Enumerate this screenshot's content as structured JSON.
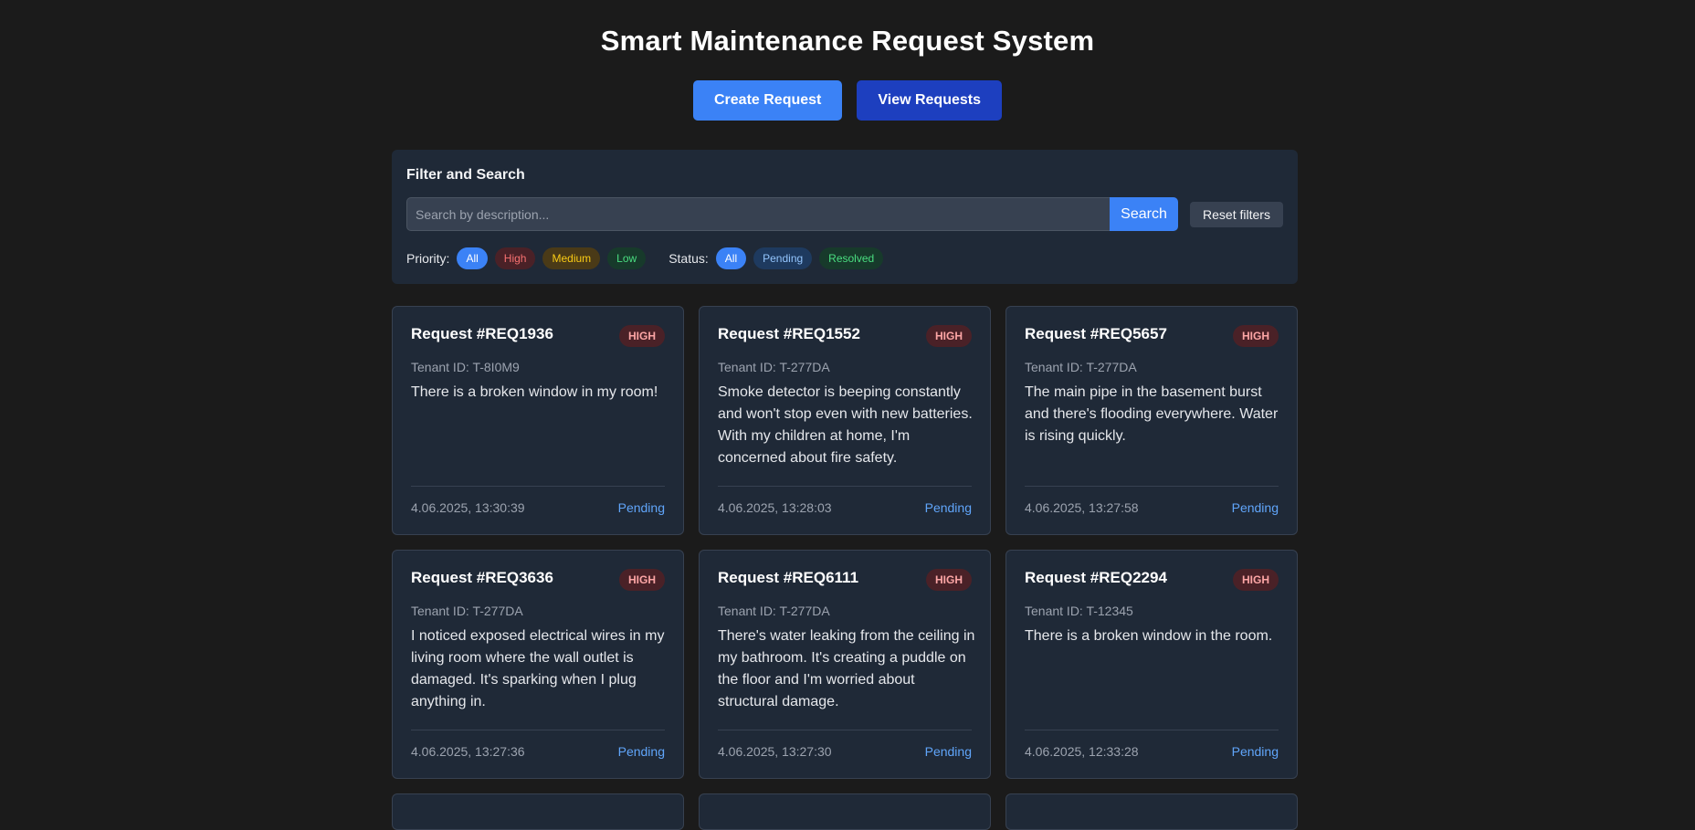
{
  "header": {
    "title": "Smart Maintenance Request System",
    "create_label": "Create Request",
    "view_label": "View Requests"
  },
  "filter": {
    "title": "Filter and Search",
    "search_placeholder": "Search by description...",
    "search_label": "Search",
    "reset_label": "Reset filters",
    "priority_label": "Priority:",
    "priority_options": [
      "All",
      "High",
      "Medium",
      "Low"
    ],
    "status_label": "Status:",
    "status_options": [
      "All",
      "Pending",
      "Resolved"
    ]
  },
  "requests": [
    {
      "title": "Request #REQ1936",
      "priority": "HIGH",
      "tenant": "Tenant ID: T-8I0M9",
      "description": "There is a broken window in my room!",
      "timestamp": "4.06.2025, 13:30:39",
      "status": "Pending"
    },
    {
      "title": "Request #REQ1552",
      "priority": "HIGH",
      "tenant": "Tenant ID: T-277DA",
      "description": "Smoke detector is beeping constantly and won't stop even with new batteries. With my children at home, I'm concerned about fire safety.",
      "timestamp": "4.06.2025, 13:28:03",
      "status": "Pending"
    },
    {
      "title": "Request #REQ5657",
      "priority": "HIGH",
      "tenant": "Tenant ID: T-277DA",
      "description": "The main pipe in the basement burst and there's flooding everywhere. Water is rising quickly.",
      "timestamp": "4.06.2025, 13:27:58",
      "status": "Pending"
    },
    {
      "title": "Request #REQ3636",
      "priority": "HIGH",
      "tenant": "Tenant ID: T-277DA",
      "description": "I noticed exposed electrical wires in my living room where the wall outlet is damaged. It's sparking when I plug anything in.",
      "timestamp": "4.06.2025, 13:27:36",
      "status": "Pending"
    },
    {
      "title": "Request #REQ6111",
      "priority": "HIGH",
      "tenant": "Tenant ID: T-277DA",
      "description": "There's water leaking from the ceiling in my bathroom. It's creating a puddle on the floor and I'm worried about structural damage.",
      "timestamp": "4.06.2025, 13:27:30",
      "status": "Pending"
    },
    {
      "title": "Request #REQ2294",
      "priority": "HIGH",
      "tenant": "Tenant ID: T-12345",
      "description": "There is a broken window in the room.",
      "timestamp": "4.06.2025, 12:33:28",
      "status": "Pending"
    }
  ]
}
